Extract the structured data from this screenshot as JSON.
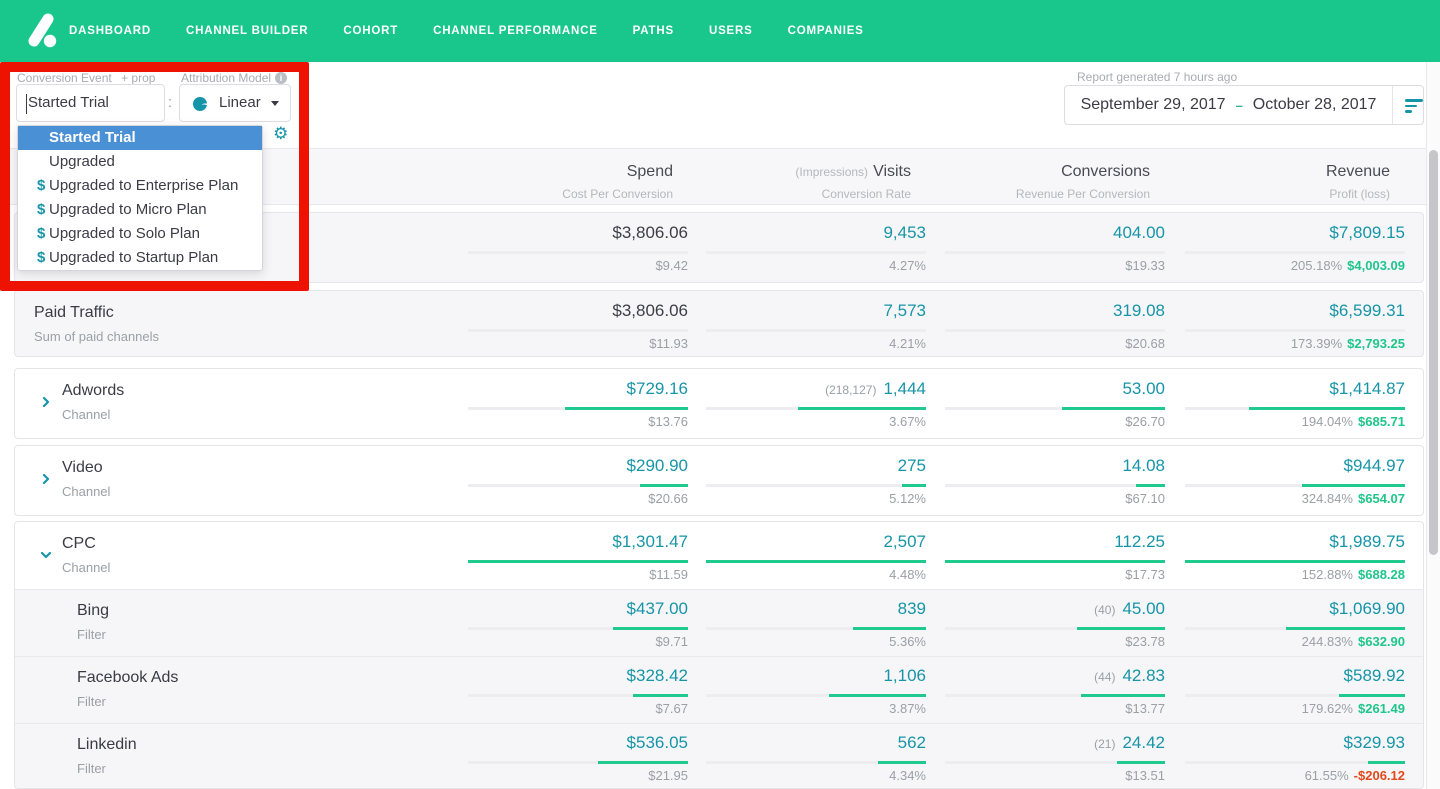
{
  "colors": {
    "nav_green": "#19c78c",
    "teal_value": "#1795a8",
    "bar_green": "#20c98d",
    "positive_green": "#1fc68b",
    "negative_red": "#e3491b",
    "selected_blue": "#4a90d4",
    "highlight_red": "#ee1202"
  },
  "nav": {
    "items": [
      "DASHBOARD",
      "CHANNEL BUILDER",
      "COHORT",
      "CHANNEL PERFORMANCE",
      "PATHS",
      "USERS",
      "COMPANIES"
    ],
    "right_icons": [
      "help-icon",
      "chat-icon",
      "gear-icon",
      "avatar",
      "chevron-down-icon"
    ]
  },
  "filters": {
    "conversion_event_label": "Conversion Event",
    "prop_label": "+ prop",
    "conversion_event_value": "Started Trial",
    "separator": ":",
    "attribution_model_label": "Attribution Model",
    "attribution_model_value": "Linear",
    "gear_separator": ":",
    "gear_icon": "⚙"
  },
  "dropdown": {
    "items": [
      {
        "label": "Started Trial",
        "dollar": false,
        "selected": true
      },
      {
        "label": "Upgraded",
        "dollar": false,
        "selected": false
      },
      {
        "label": "Upgraded to Enterprise Plan",
        "dollar": true,
        "selected": false
      },
      {
        "label": "Upgraded to Micro Plan",
        "dollar": true,
        "selected": false
      },
      {
        "label": "Upgraded to Solo Plan",
        "dollar": true,
        "selected": false
      },
      {
        "label": "Upgraded to Startup Plan",
        "dollar": true,
        "selected": false
      }
    ]
  },
  "report": {
    "generated_label": "Report generated 7 hours ago",
    "date_start": "September 29, 2017",
    "date_separator": "–",
    "date_end": "October 28, 2017"
  },
  "table": {
    "columns": [
      {
        "header": "Spend",
        "pre": "",
        "subheader": "Cost Per Conversion"
      },
      {
        "header": "Visits",
        "pre": "(Impressions)",
        "subheader": "Conversion Rate"
      },
      {
        "header": "Conversions",
        "pre": "",
        "subheader": "Revenue Per Conversion"
      },
      {
        "header": "Revenue",
        "pre": "",
        "subheader": "Profit (loss)"
      }
    ],
    "rows": [
      {
        "name": "",
        "subtitle": "",
        "kind": "summary",
        "expanded": false,
        "spend": {
          "value": "$3,806.06",
          "sub": "$9.42",
          "fill": 0
        },
        "visits": {
          "pre": "",
          "value": "9,453",
          "sub": "4.27%",
          "fill": 0
        },
        "conversions": {
          "pre": "",
          "value": "404.00",
          "sub": "$19.33",
          "fill": 0
        },
        "revenue": {
          "value": "$7,809.15",
          "pct": "205.18%",
          "profit": "$4,003.09",
          "negative": false,
          "fill": 0
        }
      },
      {
        "name": "Paid Traffic",
        "subtitle": "Sum of paid channels",
        "kind": "summary",
        "expanded": false,
        "spend": {
          "value": "$3,806.06",
          "sub": "$11.93",
          "fill": 0
        },
        "visits": {
          "pre": "",
          "value": "7,573",
          "sub": "4.21%",
          "fill": 0
        },
        "conversions": {
          "pre": "",
          "value": "319.08",
          "sub": "$20.68",
          "fill": 0
        },
        "revenue": {
          "value": "$6,599.31",
          "pct": "173.39%",
          "profit": "$2,793.25",
          "negative": false,
          "fill": 0
        }
      },
      {
        "name": "Adwords",
        "subtitle": "Channel",
        "kind": "channel",
        "expanded": false,
        "spend": {
          "value": "$729.16",
          "sub": "$13.76",
          "fill": 56
        },
        "visits": {
          "pre": "(218,127)",
          "value": "1,444",
          "sub": "3.67%",
          "fill": 58
        },
        "conversions": {
          "pre": "",
          "value": "53.00",
          "sub": "$26.70",
          "fill": 47
        },
        "revenue": {
          "value": "$1,414.87",
          "pct": "194.04%",
          "profit": "$685.71",
          "negative": false,
          "fill": 71
        }
      },
      {
        "name": "Video",
        "subtitle": "Channel",
        "kind": "channel",
        "expanded": false,
        "spend": {
          "value": "$290.90",
          "sub": "$20.66",
          "fill": 22
        },
        "visits": {
          "pre": "",
          "value": "275",
          "sub": "5.12%",
          "fill": 11
        },
        "conversions": {
          "pre": "",
          "value": "14.08",
          "sub": "$67.10",
          "fill": 13
        },
        "revenue": {
          "value": "$944.97",
          "pct": "324.84%",
          "profit": "$654.07",
          "negative": false,
          "fill": 47
        }
      },
      {
        "name": "CPC",
        "subtitle": "Channel",
        "kind": "channel",
        "expanded": true,
        "spend": {
          "value": "$1,301.47",
          "sub": "$11.59",
          "fill": 100
        },
        "visits": {
          "pre": "",
          "value": "2,507",
          "sub": "4.48%",
          "fill": 100
        },
        "conversions": {
          "pre": "",
          "value": "112.25",
          "sub": "$17.73",
          "fill": 100
        },
        "revenue": {
          "value": "$1,989.75",
          "pct": "152.88%",
          "profit": "$688.28",
          "negative": false,
          "fill": 100
        }
      },
      {
        "name": "Bing",
        "subtitle": "Filter",
        "kind": "filter",
        "expanded": false,
        "spend": {
          "value": "$437.00",
          "sub": "$9.71",
          "fill": 34
        },
        "visits": {
          "pre": "",
          "value": "839",
          "sub": "5.36%",
          "fill": 33
        },
        "conversions": {
          "pre": "(40)",
          "value": "45.00",
          "sub": "$23.78",
          "fill": 40
        },
        "revenue": {
          "value": "$1,069.90",
          "pct": "244.83%",
          "profit": "$632.90",
          "negative": false,
          "fill": 54
        }
      },
      {
        "name": "Facebook Ads",
        "subtitle": "Filter",
        "kind": "filter",
        "expanded": false,
        "spend": {
          "value": "$328.42",
          "sub": "$7.67",
          "fill": 25
        },
        "visits": {
          "pre": "",
          "value": "1,106",
          "sub": "3.87%",
          "fill": 44
        },
        "conversions": {
          "pre": "(44)",
          "value": "42.83",
          "sub": "$13.77",
          "fill": 38
        },
        "revenue": {
          "value": "$589.92",
          "pct": "179.62%",
          "profit": "$261.49",
          "negative": false,
          "fill": 30
        }
      },
      {
        "name": "Linkedin",
        "subtitle": "Filter",
        "kind": "filter",
        "expanded": false,
        "spend": {
          "value": "$536.05",
          "sub": "$21.95",
          "fill": 41
        },
        "visits": {
          "pre": "",
          "value": "562",
          "sub": "4.34%",
          "fill": 22
        },
        "conversions": {
          "pre": "(21)",
          "value": "24.42",
          "sub": "$13.51",
          "fill": 22
        },
        "revenue": {
          "value": "$329.93",
          "pct": "61.55%",
          "profit": "-$206.12",
          "negative": true,
          "fill": 17
        }
      }
    ]
  }
}
